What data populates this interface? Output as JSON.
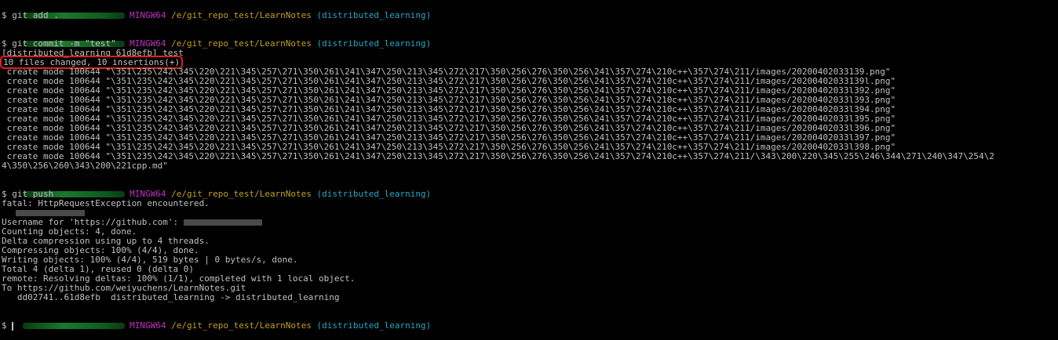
{
  "prompt1": {
    "host": "MINGW64",
    "path": "/e/git_repo_test/LearnNotes",
    "branch": "(distributed_learning)"
  },
  "cmd_add": "$ git add .",
  "prompt2": {
    "host": "MINGW64",
    "path": "/e/git_repo_test/LearnNotes",
    "branch": "(distributed_learning)"
  },
  "cmd_commit": "$ git commit -m \"test\"",
  "commit_result": "[distributed_learning 61d8efb] test",
  "commit_summary": "10 files changed, 10 insertions(+)",
  "create_lines": [
    " create mode 100644 \"\\351\\235\\242\\345\\220\\221\\345\\257\\271\\350\\261\\241\\347\\250\\213\\345\\272\\217\\350\\256\\276\\350\\256\\241\\357\\274\\210c++\\357\\274\\211/images/20200402033139.png\"",
    " create mode 100644 \"\\351\\235\\242\\345\\220\\221\\345\\257\\271\\350\\261\\241\\347\\250\\213\\345\\272\\217\\350\\256\\276\\350\\256\\241\\357\\274\\210c++\\357\\274\\211/images/20200402033139l.png\"",
    " create mode 100644 \"\\351\\235\\242\\345\\220\\221\\345\\257\\271\\350\\261\\241\\347\\250\\213\\345\\272\\217\\350\\256\\276\\350\\256\\241\\357\\274\\210c++\\357\\274\\211/images/20200402033l392.png\"",
    " create mode 100644 \"\\351\\235\\242\\345\\220\\221\\345\\257\\271\\350\\261\\241\\347\\250\\213\\345\\272\\217\\350\\256\\276\\350\\256\\241\\357\\274\\210c++\\357\\274\\211/images/20200402033l393.png\"",
    " create mode 100644 \"\\351\\235\\242\\345\\220\\221\\345\\257\\271\\350\\261\\241\\347\\250\\213\\345\\272\\217\\350\\256\\276\\350\\256\\241\\357\\274\\210c++\\357\\274\\211/images/20200402033l394.png\"",
    " create mode 100644 \"\\351\\235\\242\\345\\220\\221\\345\\257\\271\\350\\261\\241\\347\\250\\213\\345\\272\\217\\350\\256\\276\\350\\256\\241\\357\\274\\210c++\\357\\274\\211/images/20200402033l395.png\"",
    " create mode 100644 \"\\351\\235\\242\\345\\220\\221\\345\\257\\271\\350\\261\\241\\347\\250\\213\\345\\272\\217\\350\\256\\276\\350\\256\\241\\357\\274\\210c++\\357\\274\\211/images/20200402033l396.png\"",
    " create mode 100644 \"\\351\\235\\242\\345\\220\\221\\345\\257\\271\\350\\261\\241\\347\\250\\213\\345\\272\\217\\350\\256\\276\\350\\256\\241\\357\\274\\210c++\\357\\274\\211/images/20200402033l397.png\"",
    " create mode 100644 \"\\351\\235\\242\\345\\220\\221\\345\\257\\271\\350\\261\\241\\347\\250\\213\\345\\272\\217\\350\\256\\276\\350\\256\\241\\357\\274\\210c++\\357\\274\\211/images/20200402033l398.png\"",
    " create mode 100644 \"\\351\\235\\242\\345\\220\\221\\345\\257\\271\\350\\261\\241\\347\\250\\213\\345\\272\\217\\350\\256\\276\\350\\256\\241\\357\\274\\210c++\\357\\274\\211/\\343\\200\\220\\345\\255\\246\\344\\271\\240\\347\\254\\2",
    "4\\350\\256\\260\\343\\200\\221cpp.md\""
  ],
  "prompt3": {
    "host": "MINGW64",
    "path": "/e/git_repo_test/LearnNotes",
    "branch": "(distributed_learning)"
  },
  "cmd_push": "$ git push",
  "fatal": "fatal: HttpRequestException encountered.",
  "username_prompt": "Username for 'https://github.com': ",
  "push_output": [
    "Counting objects: 4, done.",
    "Delta compression using up to 4 threads.",
    "Compressing objects: 100% (4/4), done.",
    "Writing objects: 100% (4/4), 519 bytes | 0 bytes/s, done.",
    "Total 4 (delta 1), reused 0 (delta 0)",
    "remote: Resolving deltas: 100% (1/1), completed with 1 local object.",
    "To https://github.com/weiyuchens/LearnNotes.git",
    "   dd02741..61d8efb  distributed_learning -> distributed_learning"
  ],
  "prompt4": {
    "host": "MINGW64",
    "path": "/e/git_repo_test/LearnNotes",
    "branch": "(distributed_learning)"
  },
  "final_prompt": "$ ",
  "colors": {
    "background": "#000000",
    "text": "#c0c0c0",
    "host": "#bf30bf",
    "path": "#c0a020",
    "branch": "#26a6c6",
    "highlight": "#e02020"
  }
}
